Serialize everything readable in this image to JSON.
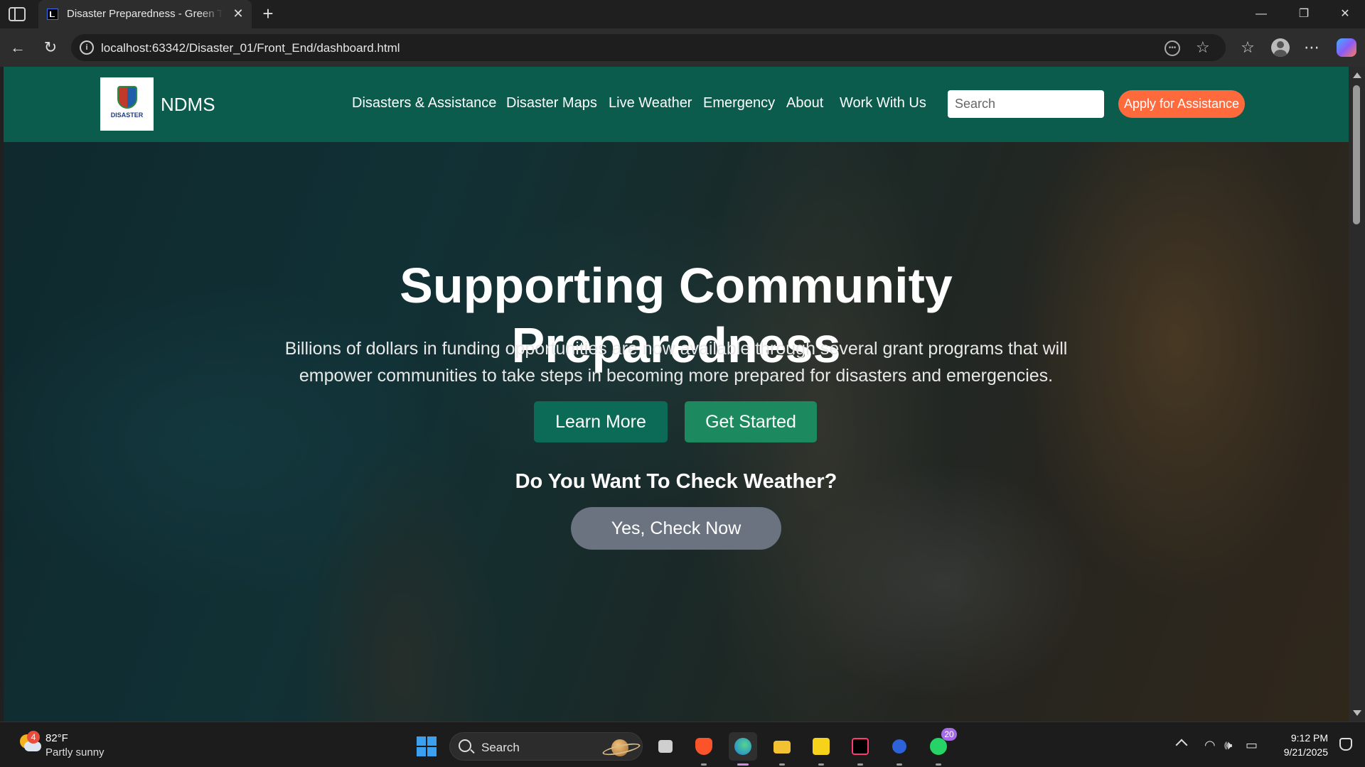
{
  "browser": {
    "tab_title": "Disaster Preparedness - Green Theme",
    "tab_close": "✕",
    "new_tab": "+",
    "url": "localhost:63342/Disaster_01/Front_End/dashboard.html",
    "window_controls": {
      "minimize": "—",
      "maximize": "❐",
      "close": "✕"
    },
    "icons": [
      "sidebar-toggle-icon",
      "back-arrow-icon",
      "refresh-icon",
      "site-info-icon",
      "reader-mode-icon",
      "favorite-star-icon",
      "favorites-list-icon",
      "profile-icon",
      "more-icon",
      "copilot-icon"
    ]
  },
  "site": {
    "logo_text": "DISASTER",
    "brand": "NDMS",
    "nav": [
      {
        "label": "Disasters & Assistance"
      },
      {
        "label": "Disaster Maps"
      },
      {
        "label": "Live Weather"
      },
      {
        "label": "Emergency"
      },
      {
        "label": "About"
      },
      {
        "label": "Work With Us"
      }
    ],
    "search_placeholder": "Search",
    "apply_label": "Apply for Assistance",
    "colors": {
      "navbar": "#0b5c4d",
      "apply": "#ff6a3d",
      "learn": "#0b6b57",
      "start": "#1c8a5e",
      "check": "#6b7280"
    }
  },
  "hero": {
    "title": "Supporting Community Preparedness",
    "subtitle": "Billions of dollars in funding opportunities are now available through several grant programs that will empower communities to take steps in becoming more prepared for disasters and emergencies.",
    "learn_more": "Learn More",
    "get_started": "Get Started",
    "weather_question": "Do You Want To Check Weather?",
    "check_now": "Yes, Check Now"
  },
  "taskbar": {
    "weather_badge": "4",
    "temperature": "82°F",
    "condition": "Partly sunny",
    "search_label": "Search",
    "whatsapp_badge": "20",
    "time": "9:12 PM",
    "date": "9/21/2025",
    "apps": [
      "task-view",
      "brave",
      "edge",
      "file-explorer",
      "sticky-notes",
      "jetbrains-ide",
      "chrome-helper",
      "whatsapp"
    ]
  }
}
